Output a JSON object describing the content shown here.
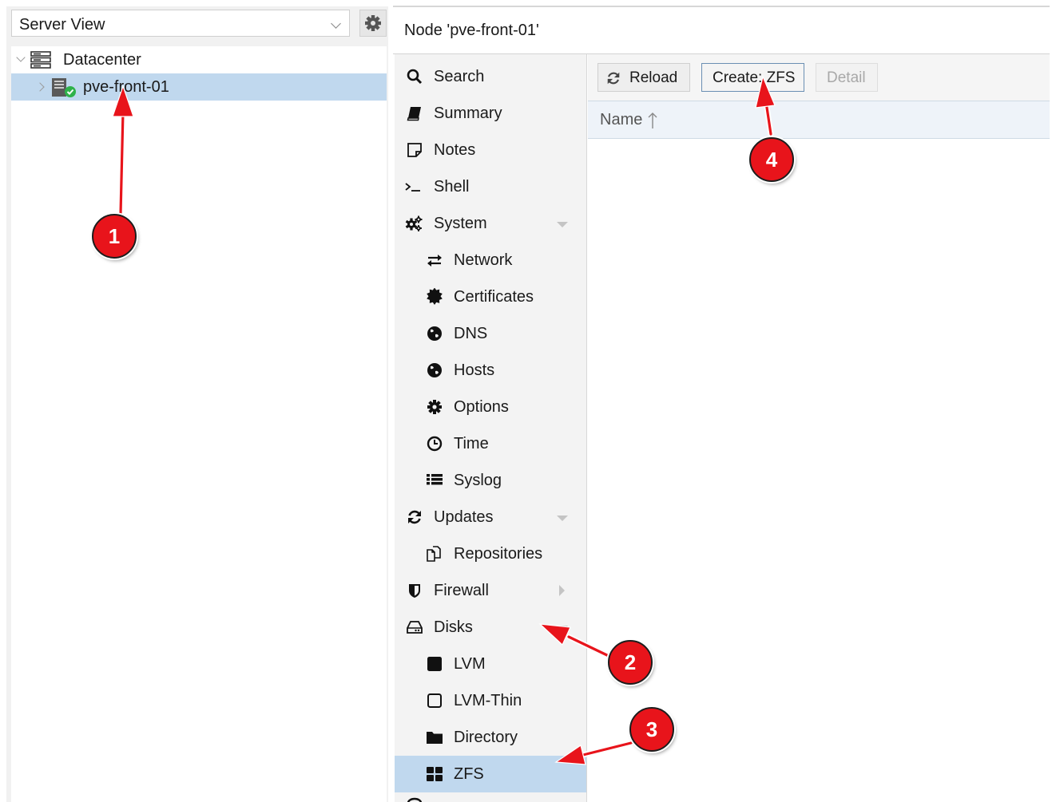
{
  "left_panel": {
    "view_selector": "Server View",
    "tree": {
      "datacenter": "Datacenter",
      "node": "pve-front-01"
    }
  },
  "header": {
    "title": "Node 'pve-front-01'"
  },
  "nav": {
    "items": [
      {
        "label": "Search",
        "icon": "search-icon"
      },
      {
        "label": "Summary",
        "icon": "book-icon"
      },
      {
        "label": "Notes",
        "icon": "sticky-note-icon"
      },
      {
        "label": "Shell",
        "icon": "terminal-icon"
      },
      {
        "label": "System",
        "icon": "cogs-icon"
      },
      {
        "label": "Network",
        "icon": "exchange-icon"
      },
      {
        "label": "Certificates",
        "icon": "certificate-icon"
      },
      {
        "label": "DNS",
        "icon": "globe-icon"
      },
      {
        "label": "Hosts",
        "icon": "globe-icon"
      },
      {
        "label": "Options",
        "icon": "gear-icon"
      },
      {
        "label": "Time",
        "icon": "clock-icon"
      },
      {
        "label": "Syslog",
        "icon": "list-icon"
      },
      {
        "label": "Updates",
        "icon": "refresh-icon"
      },
      {
        "label": "Repositories",
        "icon": "files-icon"
      },
      {
        "label": "Firewall",
        "icon": "shield-icon"
      },
      {
        "label": "Disks",
        "icon": "hdd-icon"
      },
      {
        "label": "LVM",
        "icon": "square-icon"
      },
      {
        "label": "LVM-Thin",
        "icon": "square-outline-icon"
      },
      {
        "label": "Directory",
        "icon": "folder-icon"
      },
      {
        "label": "ZFS",
        "icon": "th-large-icon"
      }
    ]
  },
  "toolbar": {
    "reload": "Reload",
    "create": "Create: ZFS",
    "detail": "Detail"
  },
  "grid": {
    "column_name": "Name"
  },
  "annotations": [
    "1",
    "2",
    "3",
    "4"
  ],
  "colors": {
    "selection": "#c0d8ee",
    "marker": "#e8141b"
  }
}
